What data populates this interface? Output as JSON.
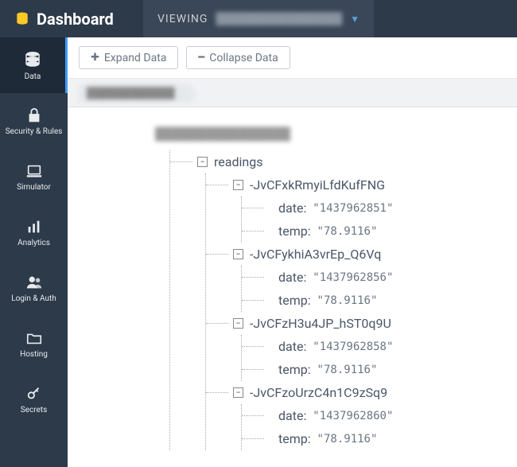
{
  "header": {
    "title": "Dashboard",
    "viewing_label": "VIEWING",
    "viewing_value": "████████████████"
  },
  "sidebar": {
    "items": [
      {
        "label": "Data",
        "icon": "database"
      },
      {
        "label": "Security & Rules",
        "icon": "lock"
      },
      {
        "label": "Simulator",
        "icon": "laptop"
      },
      {
        "label": "Analytics",
        "icon": "bars"
      },
      {
        "label": "Login & Auth",
        "icon": "users"
      },
      {
        "label": "Hosting",
        "icon": "folder"
      },
      {
        "label": "Secrets",
        "icon": "key"
      }
    ]
  },
  "toolbar": {
    "expand_label": "Expand Data",
    "collapse_label": "Collapse Data"
  },
  "breadcrumb": {
    "root": "████████████"
  },
  "tree": {
    "root_label": "████████████████",
    "readings_key": "readings",
    "entries": [
      {
        "id": "-JvCFxkRmyiLfdKufFNG",
        "fields": [
          {
            "key": "date:",
            "value": "\"1437962851\""
          },
          {
            "key": "temp:",
            "value": "\"78.9116\""
          }
        ]
      },
      {
        "id": "-JvCFykhiA3vrEp_Q6Vq",
        "fields": [
          {
            "key": "date:",
            "value": "\"1437962856\""
          },
          {
            "key": "temp:",
            "value": "\"78.9116\""
          }
        ]
      },
      {
        "id": "-JvCFzH3u4JP_hST0q9U",
        "fields": [
          {
            "key": "date:",
            "value": "\"1437962858\""
          },
          {
            "key": "temp:",
            "value": "\"78.9116\""
          }
        ]
      },
      {
        "id": "-JvCFzoUrzC4n1C9zSq9",
        "fields": [
          {
            "key": "date:",
            "value": "\"1437962860\""
          },
          {
            "key": "temp:",
            "value": "\"78.9116\""
          }
        ]
      }
    ]
  }
}
